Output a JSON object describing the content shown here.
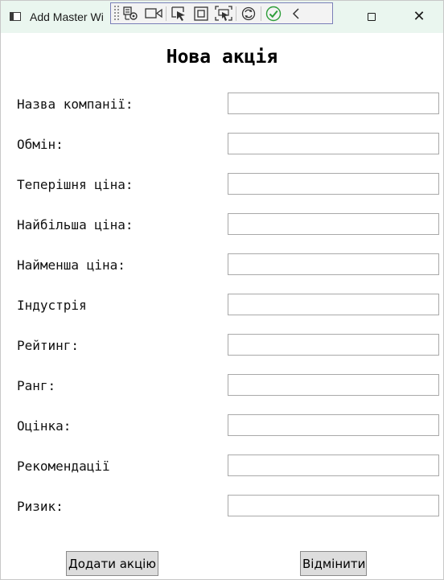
{
  "window": {
    "title": "Add Master Wi"
  },
  "debug_toolbar": {
    "buttons": [
      "live-visual-tree-icon",
      "record-icon",
      "select-element-icon",
      "display-layout-adorners-icon",
      "track-focus-icon",
      "hot-reload-icon",
      "checkmark-icon",
      "collapse-chevron-icon"
    ]
  },
  "form": {
    "heading": "Нова акція",
    "fields": [
      {
        "label": "Назва компанії:",
        "value": ""
      },
      {
        "label": "Обмін:",
        "value": ""
      },
      {
        "label": "Теперішня ціна:",
        "value": ""
      },
      {
        "label": "Найбільша ціна:",
        "value": ""
      },
      {
        "label": "Найменша ціна:",
        "value": ""
      },
      {
        "label": "Індустрія",
        "value": ""
      },
      {
        "label": "Рейтинг:",
        "value": ""
      },
      {
        "label": "Ранг:",
        "value": ""
      },
      {
        "label": "Оцінка:",
        "value": ""
      },
      {
        "label": "Рекомендації",
        "value": ""
      },
      {
        "label": "Ризик:",
        "value": ""
      }
    ],
    "add_button": "Додати акцію",
    "cancel_button": "Відмінити"
  },
  "colors": {
    "titlebar_bg": "#eaf6ef",
    "toolbar_border": "#7a7fb8",
    "check_green": "#2e9e3a",
    "button_bg": "#dddddd"
  }
}
